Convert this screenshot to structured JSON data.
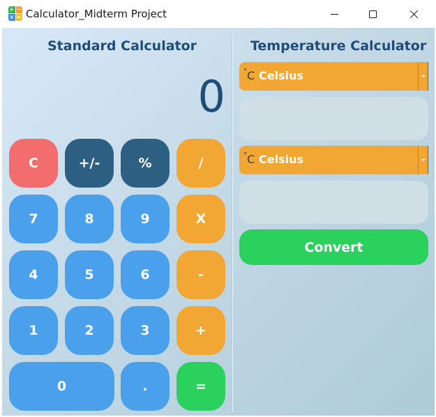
{
  "window": {
    "title": "Calculator_Midterm Project",
    "icon": "calculator-app-icon",
    "icon_glyphs": [
      "+",
      "−",
      "×",
      "="
    ]
  },
  "standard": {
    "title": "Standard Calculator",
    "display_value": "0",
    "keys": {
      "clear": "C",
      "negate": "+/-",
      "percent": "%",
      "divide": "/",
      "seven": "7",
      "eight": "8",
      "nine": "9",
      "multiply": "X",
      "four": "4",
      "five": "5",
      "six": "6",
      "subtract": "-",
      "one": "1",
      "two": "2",
      "three": "3",
      "add": "+",
      "zero": "0",
      "decimal": ".",
      "equals": "="
    }
  },
  "temperature": {
    "title": "Temperature Calculator",
    "from_unit": "Celsius",
    "to_unit": "Celsius",
    "unit_symbol": "°C",
    "from_value": "",
    "to_value": "",
    "convert_label": "Convert"
  },
  "colors": {
    "clear": "#f26d6d",
    "function": "#2d5f82",
    "operator": "#f2a735",
    "digit": "#4ba0ec",
    "equals": "#2bd15d",
    "title_text": "#1f4d78"
  }
}
